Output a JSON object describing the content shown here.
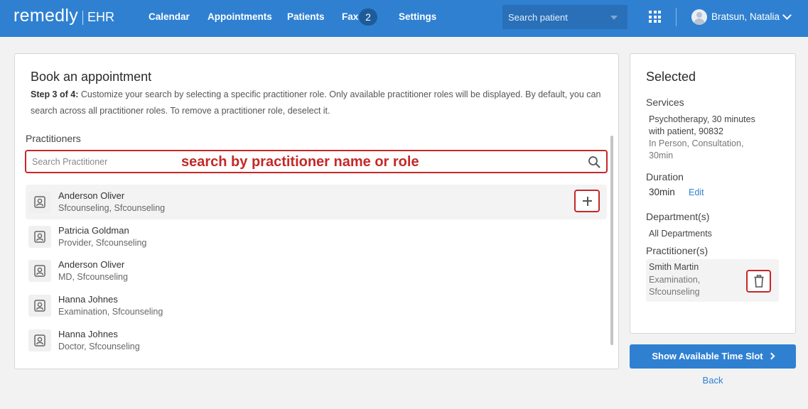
{
  "app": {
    "logo_main": "remedly",
    "logo_sub": "EHR"
  },
  "nav": {
    "items": [
      "Calendar",
      "Appointments",
      "Patients",
      "Fax",
      "Settings"
    ],
    "fax_count": "2",
    "search_placeholder": "Search patient",
    "user_name": "Bratsun, Natalia"
  },
  "main": {
    "title": "Book an appointment",
    "step_label": "Step 3 of 4:",
    "description": " Customize your search by selecting a specific practitioner role. Only available practitioner roles will be displayed. By default, you can search across all practitioner roles. To remove a practitioner role, deselect it.",
    "section_label": "Practitioners",
    "search_placeholder": "Search Practitioner",
    "search_annotation": "search by practitioner name or role",
    "practitioners": [
      {
        "name": "Anderson Oliver",
        "role": "Sfcounseling, Sfcounseling"
      },
      {
        "name": "Patricia Goldman",
        "role": "Provider, Sfcounseling"
      },
      {
        "name": "Anderson Oliver",
        "role": "MD, Sfcounseling"
      },
      {
        "name": "Hanna Johnes",
        "role": "Examination, Sfcounseling"
      },
      {
        "name": "Hanna Johnes",
        "role": "Doctor, Sfcounseling"
      }
    ]
  },
  "selected": {
    "title": "Selected",
    "services_label": "Services",
    "service_line1": "Psychotherapy, 30 minutes",
    "service_line2": "with patient, 90832",
    "service_sub1": "In Person, Consultation,",
    "service_sub2": "30min",
    "duration_label": "Duration",
    "duration_value": "30min",
    "edit_label": "Edit",
    "departments_label": "Department(s)",
    "departments_value": "All Departments",
    "practitioners_label": "Practitioner(s)",
    "practitioner_name": "Smith Martin",
    "practitioner_role1": "Examination,",
    "practitioner_role2": "Sfcounseling"
  },
  "actions": {
    "show_slots": "Show Available Time Slot",
    "back": "Back"
  },
  "colors": {
    "brand": "#2f80d1",
    "annotation_red": "#c62828"
  },
  "icons": [
    "search-icon",
    "grid-icon",
    "avatar",
    "chevron-down-icon",
    "person-icon",
    "plus-icon",
    "trash-icon",
    "chevron-right-icon"
  ]
}
